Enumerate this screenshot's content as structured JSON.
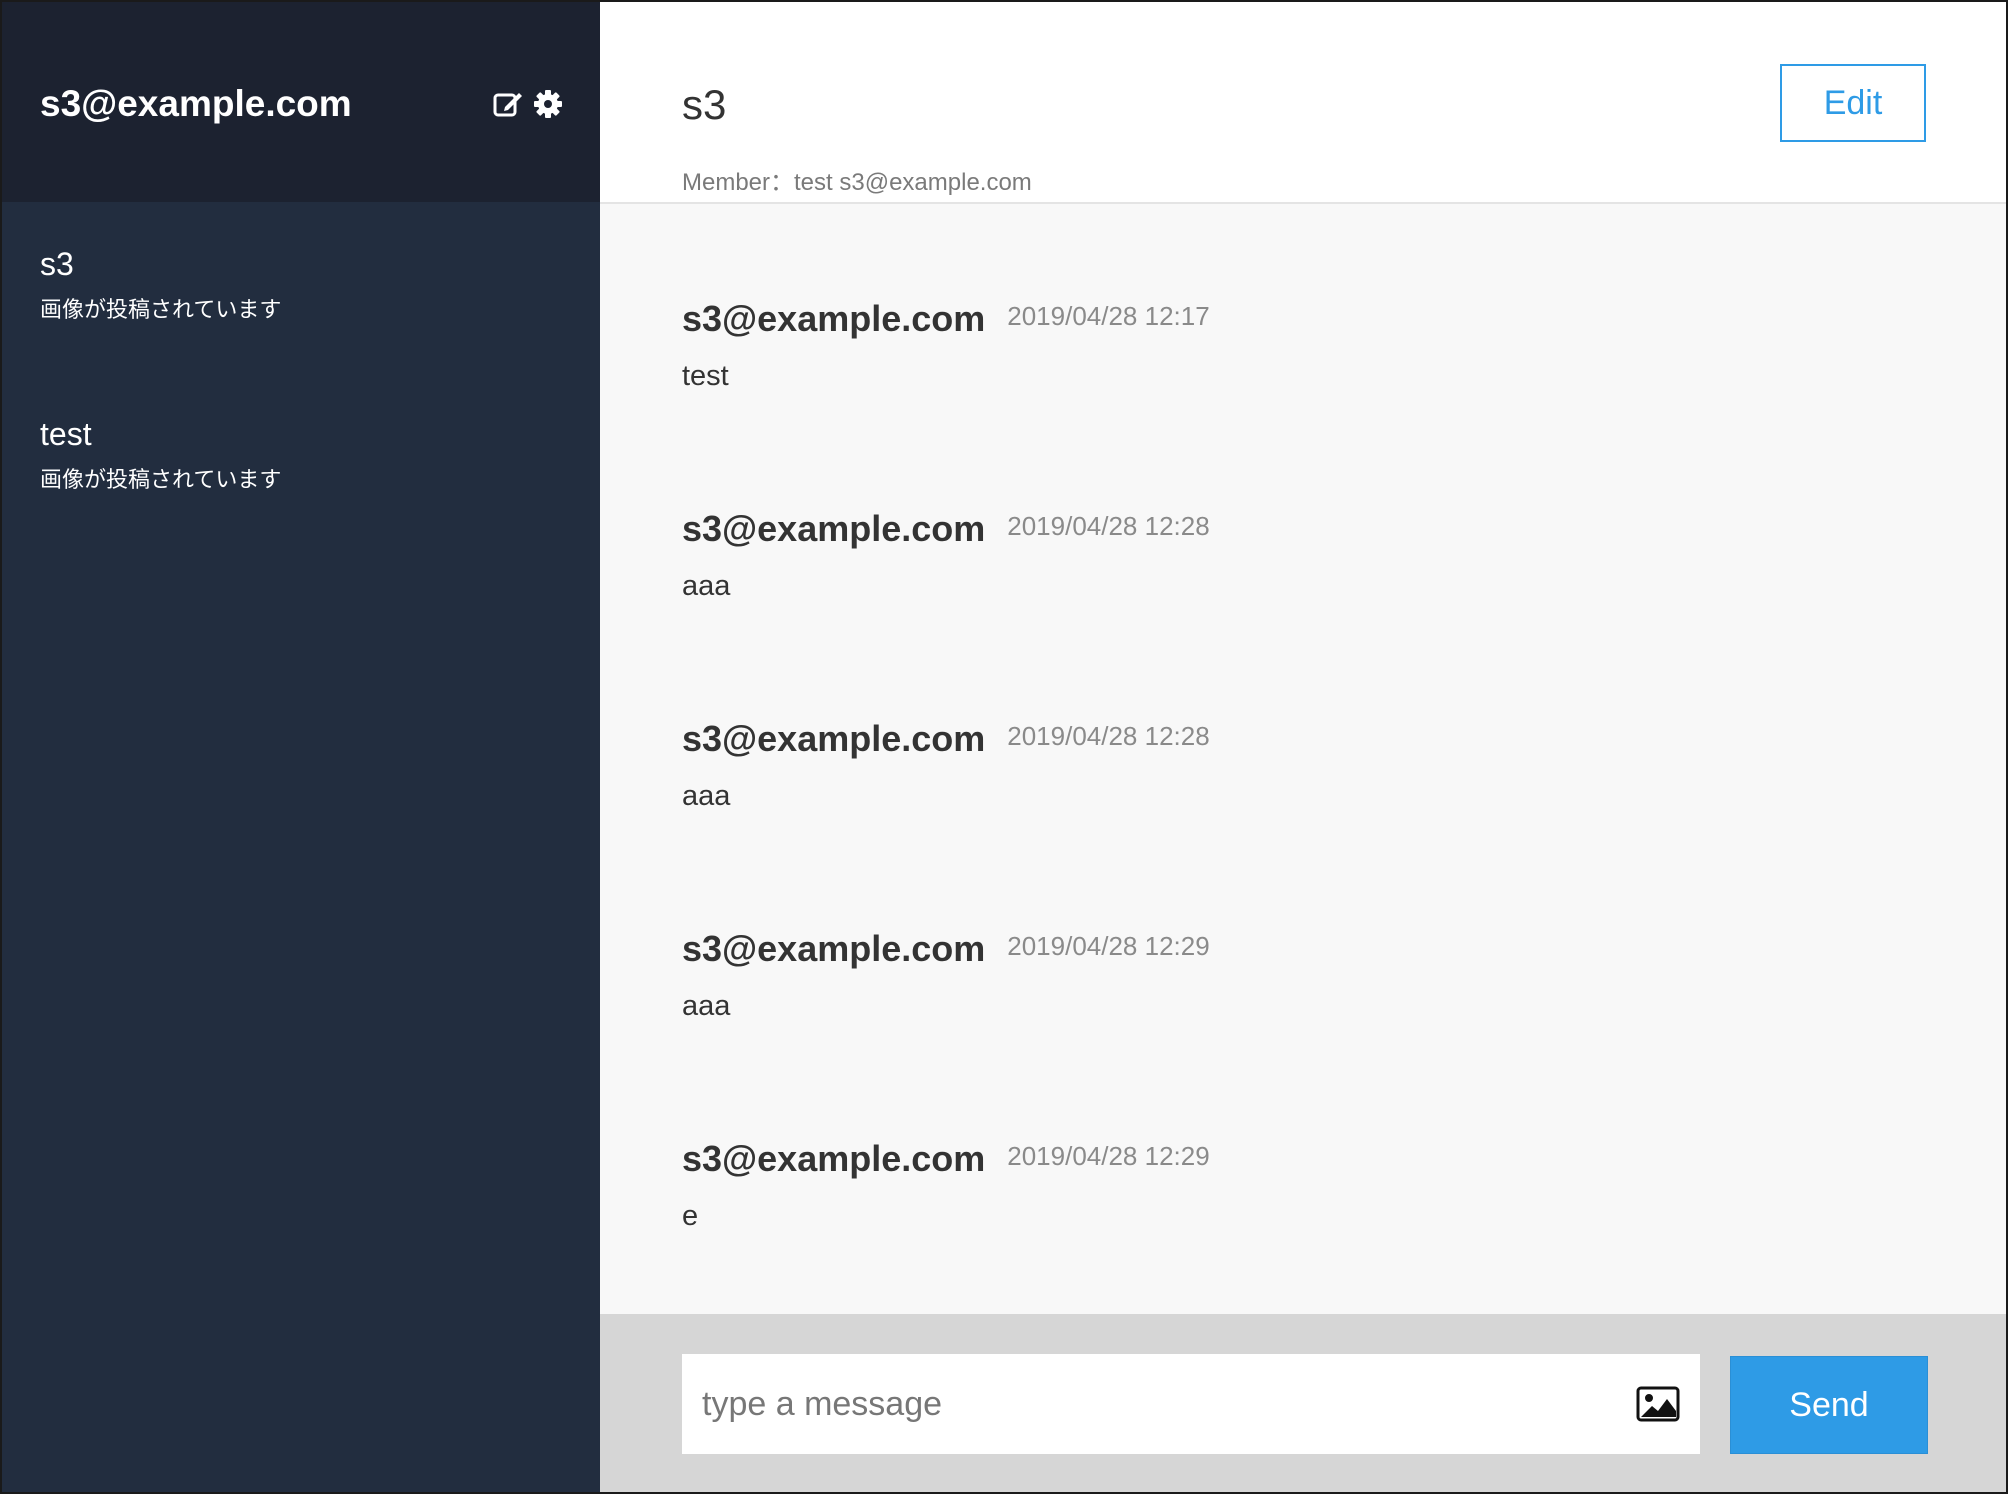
{
  "sidebar": {
    "user_email": "s3@example.com",
    "icons": [
      "edit-icon",
      "gear-icon"
    ],
    "rooms": [
      {
        "name": "s3",
        "last_message": "画像が投稿されています"
      },
      {
        "name": "test",
        "last_message": "画像が投稿されています"
      }
    ]
  },
  "header": {
    "title": "s3",
    "members": "Member：test s3@example.com",
    "edit_label": "Edit"
  },
  "messages": [
    {
      "author": "s3@example.com",
      "time": "2019/04/28 12:17",
      "body": "test"
    },
    {
      "author": "s3@example.com",
      "time": "2019/04/28 12:28",
      "body": "aaa"
    },
    {
      "author": "s3@example.com",
      "time": "2019/04/28 12:28",
      "body": "aaa"
    },
    {
      "author": "s3@example.com",
      "time": "2019/04/28 12:29",
      "body": "aaa"
    },
    {
      "author": "s3@example.com",
      "time": "2019/04/28 12:29",
      "body": "e"
    }
  ],
  "composer": {
    "placeholder": "type a message",
    "value": "",
    "image_icon": "image-icon",
    "send_label": "Send"
  },
  "colors": {
    "sidebar_bg": "#222d3f",
    "sidebar_header_bg": "#1c2230",
    "accent": "#2e9be6"
  }
}
